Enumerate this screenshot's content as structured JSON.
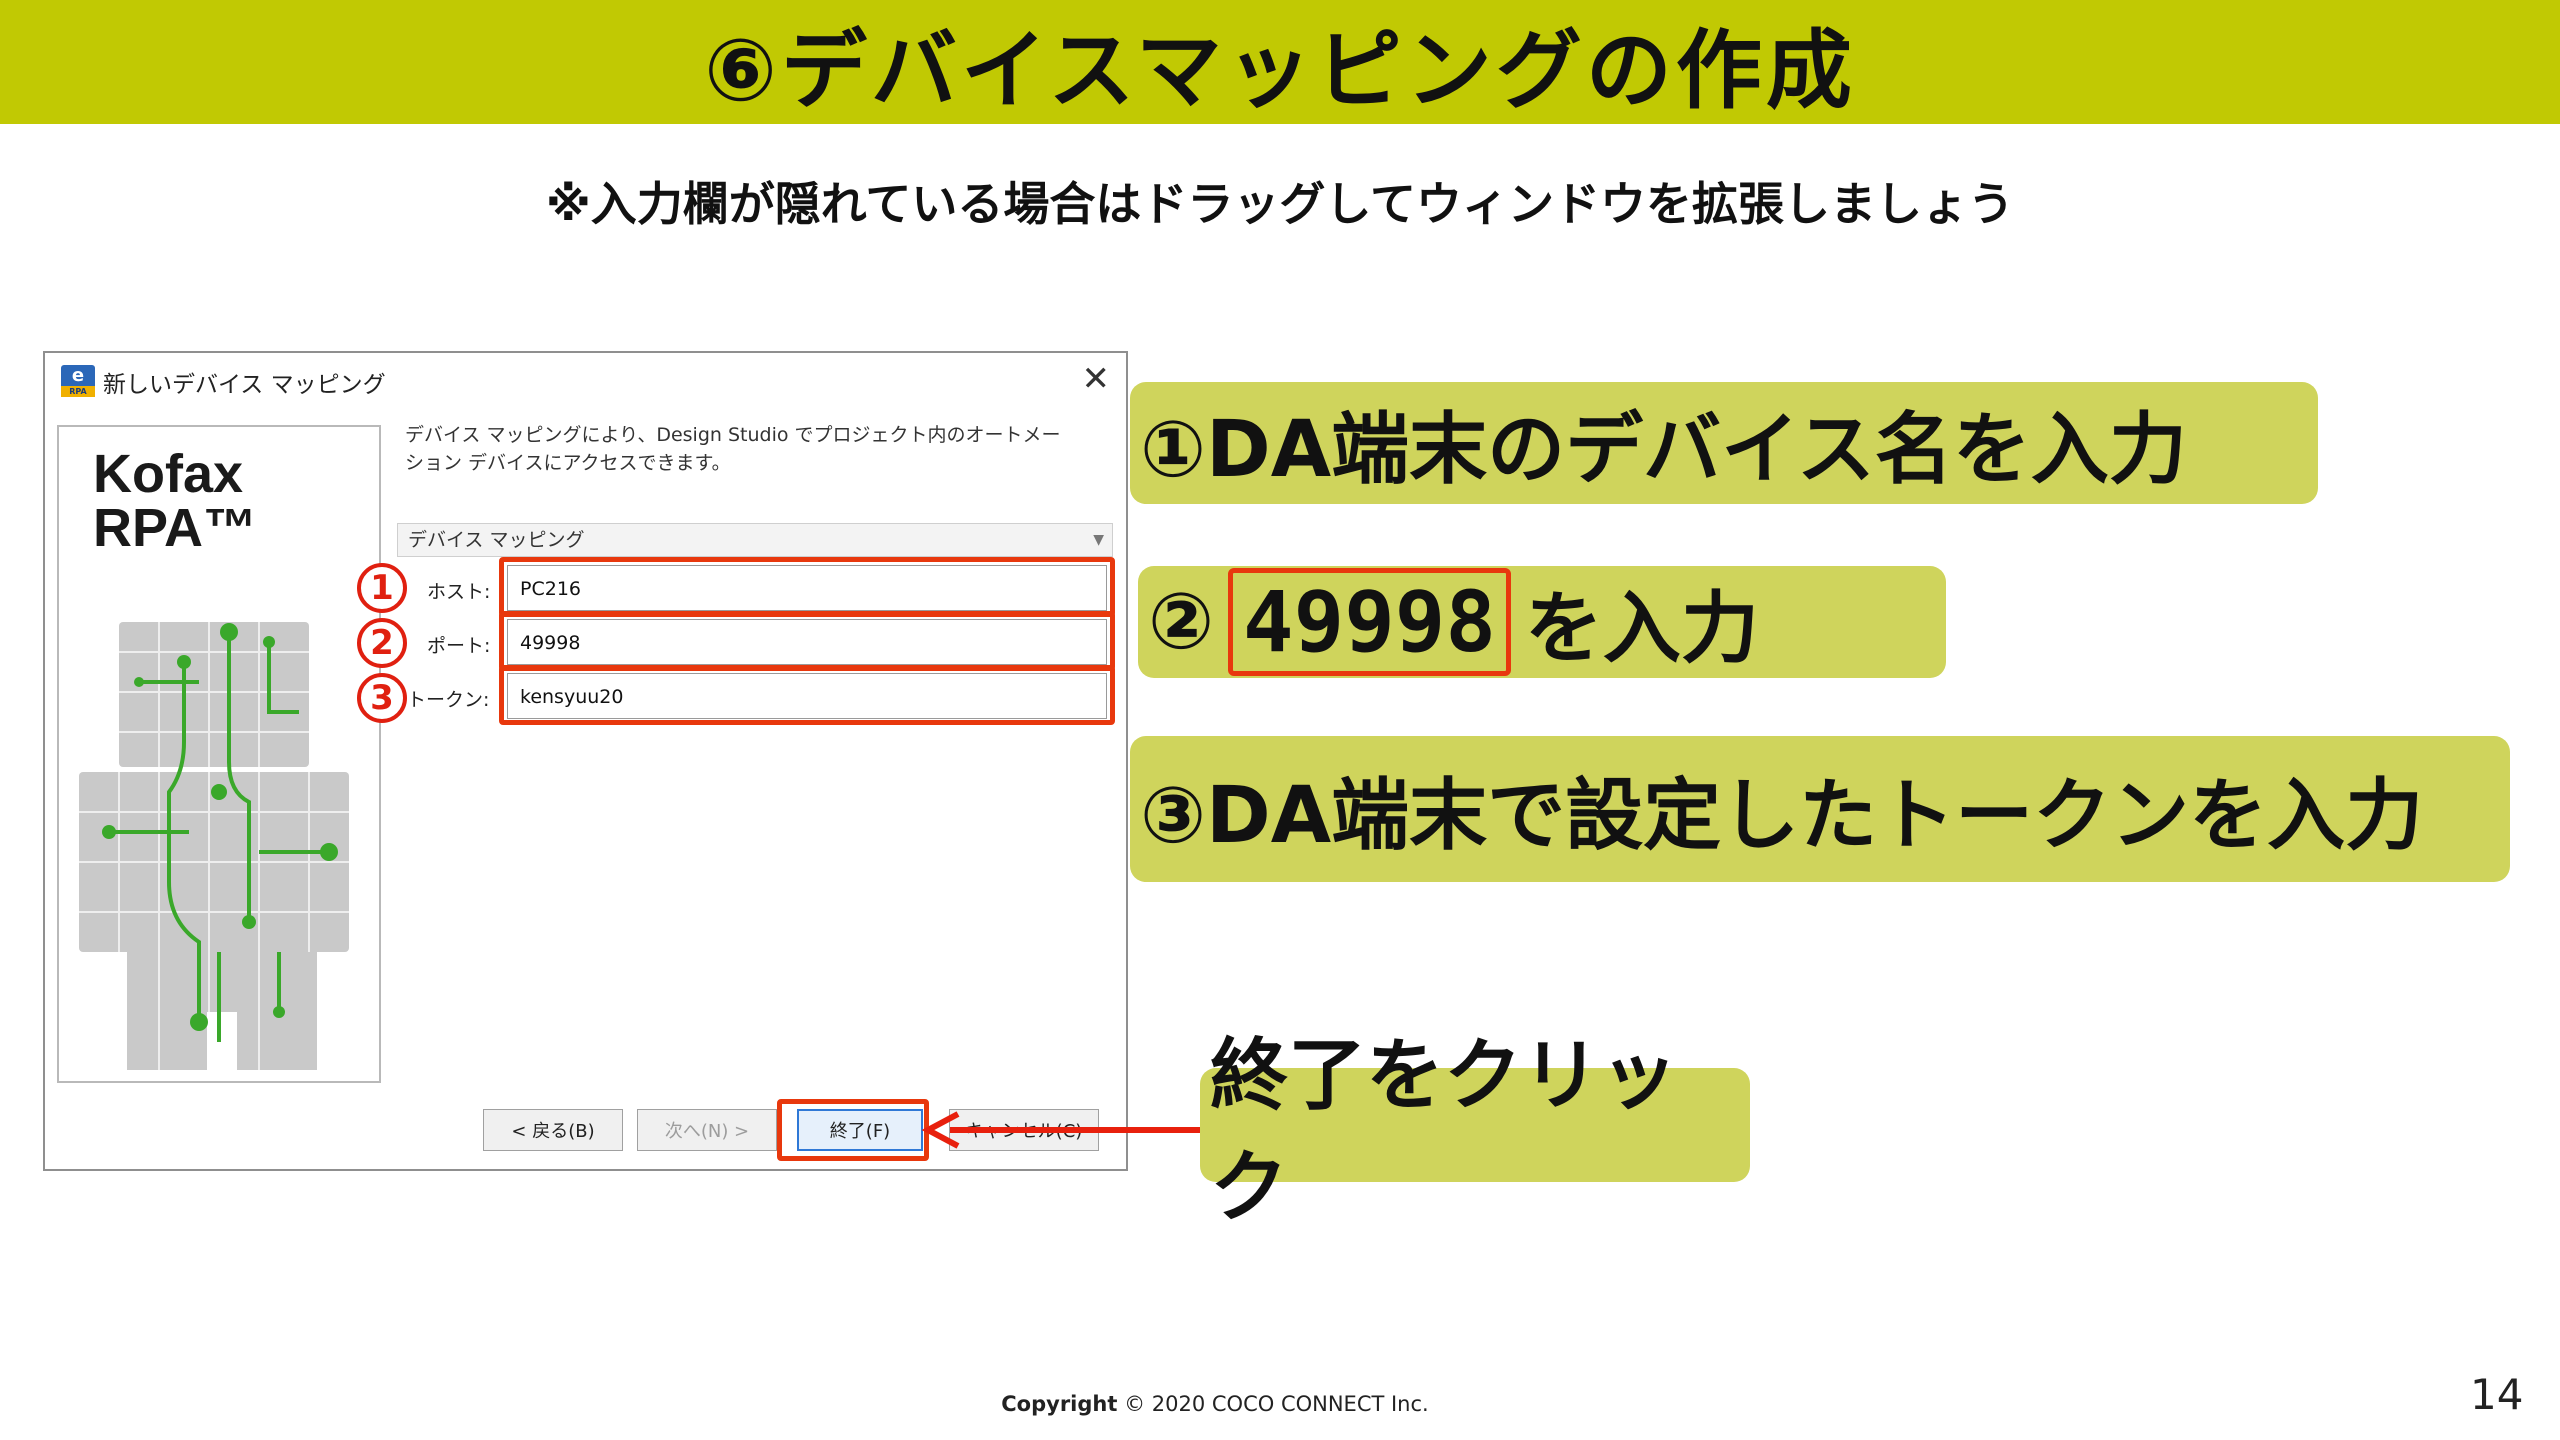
{
  "slide": {
    "title": "⑥デバイスマッピングの作成",
    "subtitle": "※入力欄が隠れている場合はドラッグしてウィンドウを拡張しましょう",
    "page_number": "14",
    "copyright_bold": "Copyright",
    "copyright_rest": "© 2020 COCO CONNECT Inc."
  },
  "dialog": {
    "icon_label": "e",
    "icon_sublabel": "RPA",
    "title": "新しいデバイス マッピング",
    "close_label": "✕",
    "brand_line1": "Kofax",
    "brand_line2": "RPA™",
    "intro_line1": "デバイス マッピングにより、Design Studio でプロジェクト内のオートメー",
    "intro_line2": "ション デバイスにアクセスできます。",
    "section_header": "デバイス マッピング",
    "fields": [
      {
        "label": "ホスト:",
        "value": "PC216",
        "marker": "1"
      },
      {
        "label": "ポート:",
        "value": "49998",
        "marker": "2"
      },
      {
        "label": "トークン:",
        "value": "kensyuu20",
        "marker": "3"
      }
    ],
    "buttons": {
      "back": "< 戻る(B)",
      "next": "次へ(N) >",
      "finish": "終了(F)",
      "cancel": "キャンセル(C)"
    }
  },
  "callouts": {
    "c1": "①DA端末のデバイス名を入力",
    "c2_prefix": "②",
    "c2_number": "49998",
    "c2_suffix": "を入力",
    "c3": "③DA端末で設定したトークンを入力",
    "c4": "終了をクリック"
  },
  "colors": {
    "title_bar": "#c1c903",
    "callout_bg": "#cfd45c",
    "highlight_red": "#e8380d"
  }
}
